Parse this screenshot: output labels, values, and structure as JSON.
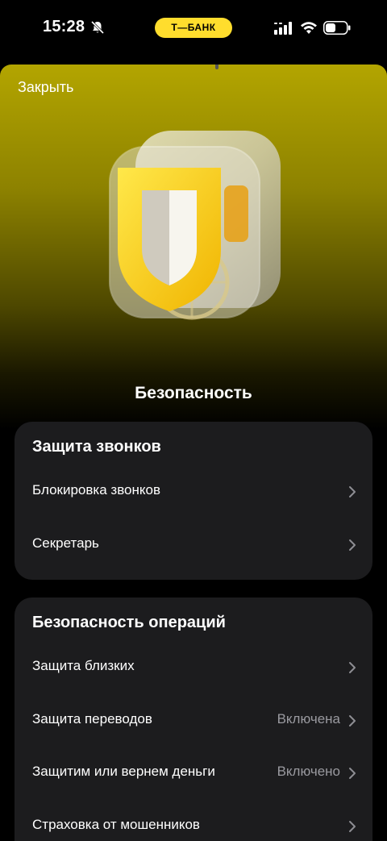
{
  "status_bar": {
    "time": "15:28",
    "brand": "Т—БАНК",
    "brand_color": "#FFDD2D"
  },
  "sheet": {
    "close_label": "Закрыть",
    "hero_icon": "shield-icon",
    "title": "Безопасность"
  },
  "sections": [
    {
      "title": "Защита звонков",
      "items": [
        {
          "label": "Блокировка звонков",
          "value": ""
        },
        {
          "label": "Секретарь",
          "value": ""
        }
      ]
    },
    {
      "title": "Безопасность операций",
      "items": [
        {
          "label": "Защита близких",
          "value": ""
        },
        {
          "label": "Защита переводов",
          "value": "Включена"
        },
        {
          "label": "Защитим или вернем деньги",
          "value": "Включено"
        },
        {
          "label": "Страховка от мошенников",
          "value": ""
        }
      ]
    }
  ],
  "colors": {
    "accent": "#FFDD2D",
    "card_bg": "#1c1c1e",
    "secondary_text": "#9a9aa0"
  }
}
